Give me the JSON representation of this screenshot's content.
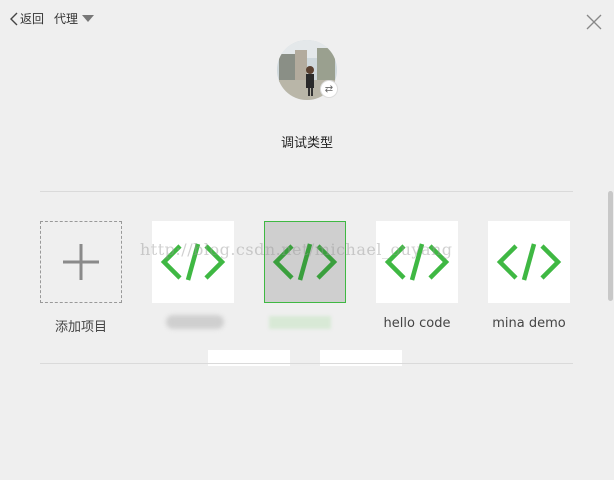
{
  "header": {
    "back_label": "返回",
    "proxy_label": "代理"
  },
  "profile": {
    "switch_icon": "⇄"
  },
  "title": "调试类型",
  "projects": [
    {
      "label": "添加项目",
      "icon": "plus-icon"
    },
    {
      "label": "",
      "icon": "code-icon"
    },
    {
      "label": "",
      "icon": "code-icon",
      "selected": true
    },
    {
      "label": "hello code",
      "icon": "code-icon"
    },
    {
      "label": "mina demo",
      "icon": "code-icon"
    }
  ],
  "watermark": "http://blog.csdn.net/michael_ouyang",
  "colors": {
    "accent_green": "#3fb843",
    "background": "#efefef",
    "tile_bg": "#ffffff",
    "selected_bg": "#cfcfcf"
  }
}
